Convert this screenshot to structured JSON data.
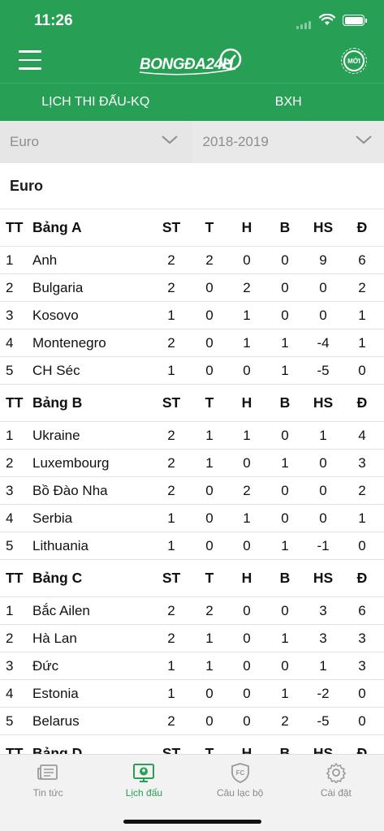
{
  "status_bar": {
    "time": "11:26"
  },
  "app_bar": {
    "logo_text": "BONGĐA24H",
    "new_badge": "MỚI"
  },
  "tabs": [
    {
      "label": "LỊCH THI ĐẤU-KQ"
    },
    {
      "label": "BXH"
    }
  ],
  "filters": {
    "competition": "Euro",
    "season": "2018-2019"
  },
  "section_title": "Euro",
  "columns": {
    "st": "ST",
    "t": "T",
    "h": "H",
    "b": "B",
    "hs": "HS",
    "d": "Đ",
    "tt": "TT"
  },
  "groups": [
    {
      "name": "Bảng A",
      "rows": [
        {
          "tt": "1",
          "team": "Anh",
          "st": "2",
          "t": "2",
          "h": "0",
          "b": "0",
          "hs": "9",
          "d": "6"
        },
        {
          "tt": "2",
          "team": "Bulgaria",
          "st": "2",
          "t": "0",
          "h": "2",
          "b": "0",
          "hs": "0",
          "d": "2"
        },
        {
          "tt": "3",
          "team": "Kosovo",
          "st": "1",
          "t": "0",
          "h": "1",
          "b": "0",
          "hs": "0",
          "d": "1"
        },
        {
          "tt": "4",
          "team": "Montenegro",
          "st": "2",
          "t": "0",
          "h": "1",
          "b": "1",
          "hs": "-4",
          "d": "1"
        },
        {
          "tt": "5",
          "team": "CH Séc",
          "st": "1",
          "t": "0",
          "h": "0",
          "b": "1",
          "hs": "-5",
          "d": "0"
        }
      ]
    },
    {
      "name": "Bảng B",
      "rows": [
        {
          "tt": "1",
          "team": "Ukraine",
          "st": "2",
          "t": "1",
          "h": "1",
          "b": "0",
          "hs": "1",
          "d": "4"
        },
        {
          "tt": "2",
          "team": "Luxembourg",
          "st": "2",
          "t": "1",
          "h": "0",
          "b": "1",
          "hs": "0",
          "d": "3"
        },
        {
          "tt": "3",
          "team": "Bồ Đào Nha",
          "st": "2",
          "t": "0",
          "h": "2",
          "b": "0",
          "hs": "0",
          "d": "2"
        },
        {
          "tt": "4",
          "team": "Serbia",
          "st": "1",
          "t": "0",
          "h": "1",
          "b": "0",
          "hs": "0",
          "d": "1"
        },
        {
          "tt": "5",
          "team": "Lithuania",
          "st": "1",
          "t": "0",
          "h": "0",
          "b": "1",
          "hs": "-1",
          "d": "0"
        }
      ]
    },
    {
      "name": "Bảng C",
      "rows": [
        {
          "tt": "1",
          "team": "Bắc Ailen",
          "st": "2",
          "t": "2",
          "h": "0",
          "b": "0",
          "hs": "3",
          "d": "6"
        },
        {
          "tt": "2",
          "team": "Hà Lan",
          "st": "2",
          "t": "1",
          "h": "0",
          "b": "1",
          "hs": "3",
          "d": "3"
        },
        {
          "tt": "3",
          "team": "Đức",
          "st": "1",
          "t": "1",
          "h": "0",
          "b": "0",
          "hs": "1",
          "d": "3"
        },
        {
          "tt": "4",
          "team": "Estonia",
          "st": "1",
          "t": "0",
          "h": "0",
          "b": "1",
          "hs": "-2",
          "d": "0"
        },
        {
          "tt": "5",
          "team": "Belarus",
          "st": "2",
          "t": "0",
          "h": "0",
          "b": "2",
          "hs": "-5",
          "d": "0"
        }
      ]
    },
    {
      "name": "Bảng D",
      "rows": []
    }
  ],
  "bottom_nav": [
    {
      "label": "Tin tức",
      "icon": "news-icon",
      "active": false
    },
    {
      "label": "Lịch đấu",
      "icon": "schedule-icon",
      "active": true
    },
    {
      "label": "Câu lạc bộ",
      "icon": "club-icon",
      "active": false
    },
    {
      "label": "Cài đặt",
      "icon": "settings-icon",
      "active": false
    }
  ],
  "colors": {
    "brand_green": "#27a055",
    "inactive_gray": "#8a8a8a"
  }
}
